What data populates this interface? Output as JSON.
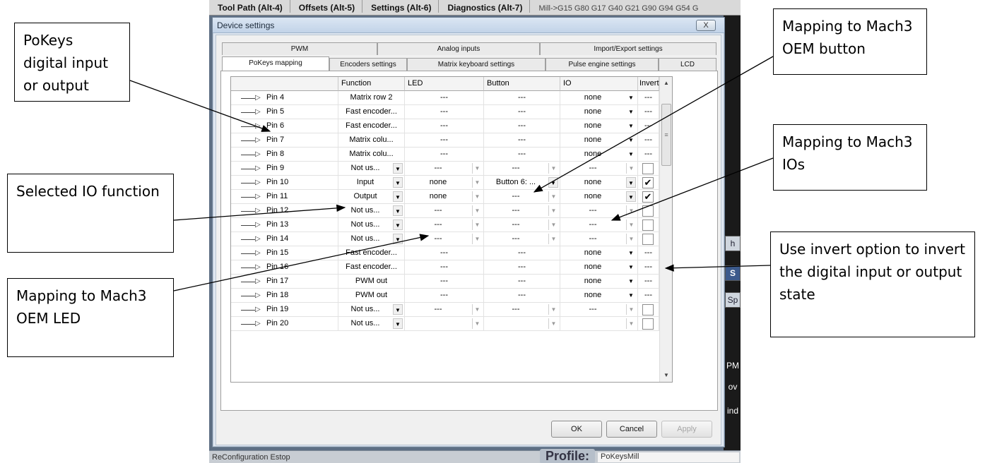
{
  "app": {
    "top_tabs": [
      "Tool Path (Alt-4)",
      "Offsets (Alt-5)",
      "Settings (Alt-6)",
      "Diagnostics (Alt-7)"
    ],
    "gcode_line": "Mill->G15  G80 G17 G40 G21 G90 G94 G54 G",
    "status_text": "ReConfiguration Estop",
    "profile_label": "Profile:",
    "profile_value": "PoKeysMill",
    "side_fragments": [
      "h",
      "S",
      "Sp",
      "PM",
      "ov",
      "ind"
    ]
  },
  "dialog": {
    "title": "Device settings",
    "close_label": "X",
    "tabs_row1": [
      "PWM",
      "Analog inputs",
      "Import/Export settings"
    ],
    "tabs_row2": [
      "PoKeys mapping",
      "Encoders settings",
      "Matrix keyboard settings",
      "Pulse engine settings",
      "LCD"
    ],
    "active_tab": "PoKeys mapping",
    "grid": {
      "headers": [
        "Function",
        "LED",
        "Button",
        "IO",
        "Invert"
      ],
      "rows": [
        {
          "pin": "Pin 4",
          "function": "Matrix row 2",
          "led": "---",
          "button": "---",
          "io": "none",
          "invert": "---",
          "editable": false
        },
        {
          "pin": "Pin 5",
          "function": "Fast encoder...",
          "led": "---",
          "button": "---",
          "io": "none",
          "invert": "---",
          "editable": false
        },
        {
          "pin": "Pin 6",
          "function": "Fast encoder...",
          "led": "---",
          "button": "---",
          "io": "none",
          "invert": "---",
          "editable": false
        },
        {
          "pin": "Pin 7",
          "function": "Matrix colu...",
          "led": "---",
          "button": "---",
          "io": "none",
          "invert": "---",
          "editable": false
        },
        {
          "pin": "Pin 8",
          "function": "Matrix colu...",
          "led": "---",
          "button": "---",
          "io": "none",
          "invert": "---",
          "editable": false
        },
        {
          "pin": "Pin 9",
          "function": "Not us...",
          "led": "---",
          "button": "---",
          "io": "---",
          "invert": "",
          "editable": true,
          "checked": false
        },
        {
          "pin": "Pin 10",
          "function": "Input",
          "led": "none",
          "button": "Button 6: ...",
          "io": "none",
          "invert": "",
          "editable": true,
          "checked": true
        },
        {
          "pin": "Pin 11",
          "function": "Output",
          "led": "none",
          "button": "---",
          "io": "none",
          "invert": "",
          "editable": true,
          "checked": true
        },
        {
          "pin": "Pin 12",
          "function": "Not us...",
          "led": "---",
          "button": "---",
          "io": "---",
          "invert": "",
          "editable": true,
          "checked": false
        },
        {
          "pin": "Pin 13",
          "function": "Not us...",
          "led": "---",
          "button": "---",
          "io": "---",
          "invert": "",
          "editable": true,
          "checked": false
        },
        {
          "pin": "Pin 14",
          "function": "Not us...",
          "led": "---",
          "button": "---",
          "io": "---",
          "invert": "",
          "editable": true,
          "checked": false
        },
        {
          "pin": "Pin 15",
          "function": "Fast encoder...",
          "led": "---",
          "button": "---",
          "io": "none",
          "invert": "---",
          "editable": false
        },
        {
          "pin": "Pin 16",
          "function": "Fast encoder...",
          "led": "---",
          "button": "---",
          "io": "none",
          "invert": "---",
          "editable": false
        },
        {
          "pin": "Pin 17",
          "function": "PWM out",
          "led": "---",
          "button": "---",
          "io": "none",
          "invert": "---",
          "editable": false
        },
        {
          "pin": "Pin 18",
          "function": "PWM out",
          "led": "---",
          "button": "---",
          "io": "none",
          "invert": "---",
          "editable": false
        },
        {
          "pin": "Pin 19",
          "function": "Not us...",
          "led": "---",
          "button": "---",
          "io": "---",
          "invert": "",
          "editable": true,
          "checked": false
        },
        {
          "pin": "Pin 20",
          "function": "Not us...",
          "led": "",
          "button": "",
          "io": "",
          "invert": "",
          "editable": true,
          "checked": false
        }
      ]
    },
    "buttons": {
      "ok": "OK",
      "cancel": "Cancel",
      "apply": "Apply"
    }
  },
  "annotations": {
    "pokeys_io": "PoKeys digital input or output",
    "selected_function": "Selected IO function",
    "oem_led": "Mapping to Mach3 OEM LED",
    "oem_button": "Mapping to Mach3 OEM button",
    "mach3_ios": "Mapping to Mach3 IOs",
    "invert": "Use invert option to invert the digital input or output state"
  },
  "colors": {
    "checkmark": "#000000",
    "dialog_bg": "#dfe7f1",
    "app_bg": "#5e6f84"
  }
}
